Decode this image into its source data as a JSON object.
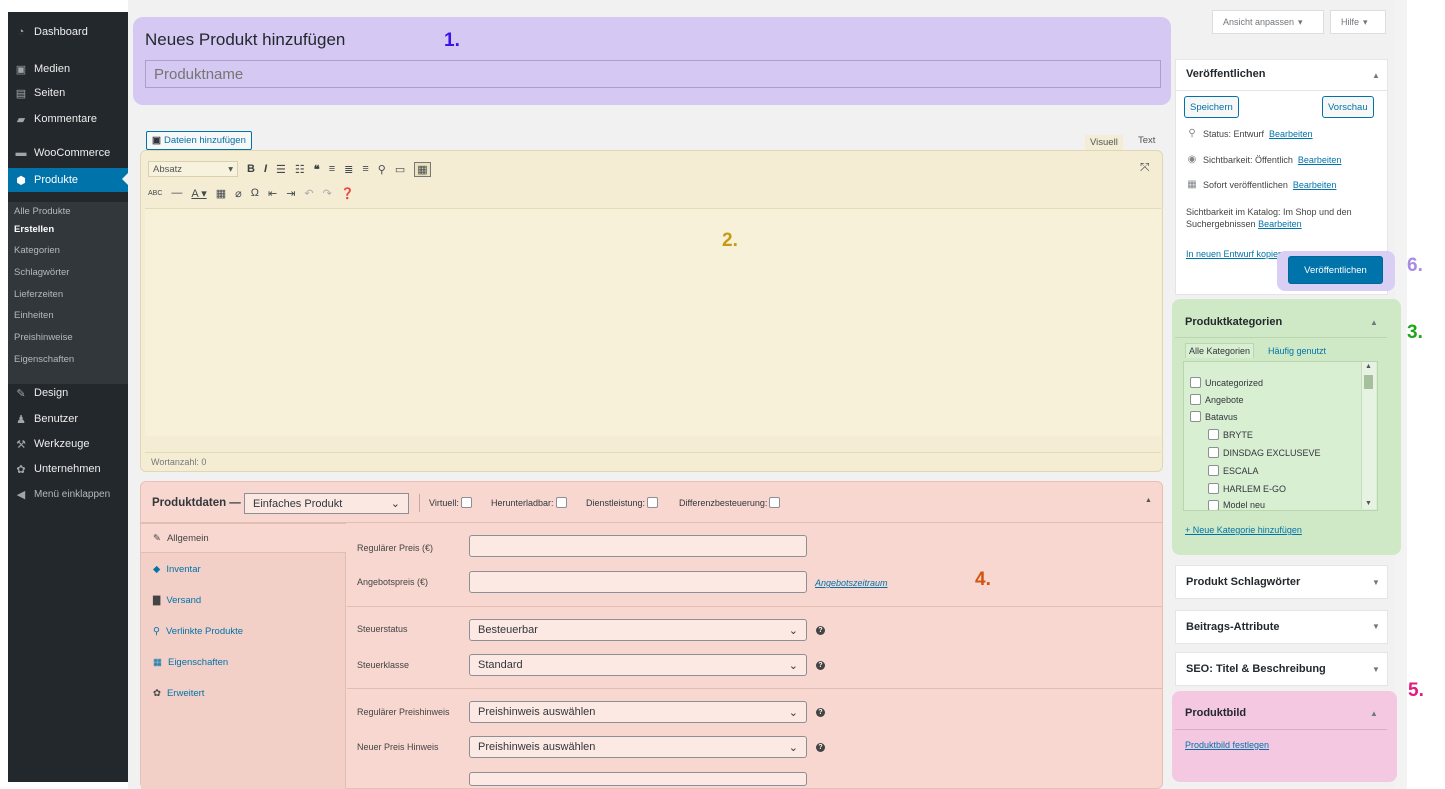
{
  "sidebar": {
    "items": [
      {
        "label": "Dashboard",
        "icon": "dashboard-icon"
      },
      {
        "label": "Medien",
        "icon": "media-icon"
      },
      {
        "label": "Seiten",
        "icon": "pages-icon"
      },
      {
        "label": "Kommentare",
        "icon": "comments-icon"
      },
      {
        "label": "WooCommerce",
        "icon": "woocommerce-icon"
      },
      {
        "label": "Produkte",
        "icon": "products-icon"
      },
      {
        "label": "Design",
        "icon": "brush-icon"
      },
      {
        "label": "Benutzer",
        "icon": "users-icon"
      },
      {
        "label": "Werkzeuge",
        "icon": "wrench-icon"
      },
      {
        "label": "Unternehmen",
        "icon": "gear-icon"
      },
      {
        "label": "Menü einklappen",
        "icon": "collapse-icon"
      }
    ],
    "submenu": [
      "Alle Produkte",
      "Erstellen",
      "Kategorien",
      "Schlagwörter",
      "Lieferzeiten",
      "Einheiten",
      "Preishinweise",
      "Eigenschaften"
    ]
  },
  "title_section": {
    "heading": "Neues Produkt hinzufügen",
    "name_placeholder": "Produktname"
  },
  "markers": {
    "m1": "1.",
    "m2": "2.",
    "m3": "3.",
    "m4": "4.",
    "m5": "5.",
    "m6": "6."
  },
  "marker_colors": {
    "m1": "#3b14e6",
    "m2": "#c69a11",
    "m3": "#22a51d",
    "m4": "#d2540f",
    "m5": "#e01a7e",
    "m6": "#a98be6"
  },
  "editor": {
    "add_media": "Dateien hinzufügen",
    "tab_visual": "Visuell",
    "tab_text": "Text",
    "format": "Absatz",
    "wordcount": "Wortanzahl: 0"
  },
  "product_data": {
    "title": "Produktdaten —",
    "type": "Einfaches Produkt",
    "checks": [
      "Virtuell:",
      "Herunterladbar:",
      "Dienstleistung:",
      "Differenzbesteuerung:"
    ],
    "tabs": [
      {
        "label": "Allgemein",
        "icon": "wrench-icon"
      },
      {
        "label": "Inventar",
        "icon": "tag-icon"
      },
      {
        "label": "Versand",
        "icon": "truck-icon"
      },
      {
        "label": "Verlinkte Produkte",
        "icon": "link-icon"
      },
      {
        "label": "Eigenschaften",
        "icon": "table-icon"
      },
      {
        "label": "Erweitert",
        "icon": "gear-icon"
      }
    ],
    "fields": {
      "regular_price": "Regulärer Preis (€)",
      "sale_price": "Angebotspreis (€)",
      "sale_schedule": "Angebotszeitraum",
      "tax_status_label": "Steuerstatus",
      "tax_status_value": "Besteuerbar",
      "tax_class_label": "Steuerklasse",
      "tax_class_value": "Standard",
      "regular_hint_label": "Regulärer Preishinweis",
      "regular_hint_value": "Preishinweis auswählen",
      "new_hint_label": "Neuer Preis Hinweis",
      "new_hint_value": "Preishinweis auswählen"
    }
  },
  "screen_options": {
    "customize": "Ansicht anpassen",
    "help": "Hilfe"
  },
  "publish": {
    "title": "Veröffentlichen",
    "save": "Speichern",
    "preview": "Vorschau",
    "status": "Status: Entwurf",
    "visibility": "Sichtbarkeit: Öffentlich",
    "schedule": "Sofort veröffentlichen",
    "edit": "Bearbeiten",
    "catalog_visibility": "Sichtbarkeit im Katalog: Im Shop und den Suchergebnissen",
    "copy_draft": "In neuen Entwurf kopieren",
    "publish_button": "Veröffentlichen"
  },
  "categories": {
    "title": "Produktkategorien",
    "tab_all": "Alle Kategorien",
    "tab_popular": "Häufig genutzt",
    "items": [
      {
        "label": "Uncategorized",
        "level": 0
      },
      {
        "label": "Angebote",
        "level": 0
      },
      {
        "label": "Batavus",
        "level": 0
      },
      {
        "label": "BRYTE",
        "level": 1
      },
      {
        "label": "DINSDAG EXCLUSEVE",
        "level": 1
      },
      {
        "label": "ESCALA",
        "level": 1
      },
      {
        "label": "HARLEM E-GO",
        "level": 1
      },
      {
        "label": "Model neu",
        "level": 1
      }
    ],
    "add_new": "+ Neue Kategorie hinzufügen"
  },
  "boxes": {
    "tags": "Produkt Schlagwörter",
    "attributes": "Beitrags-Attribute",
    "seo": "SEO: Titel & Beschreibung"
  },
  "product_image": {
    "title": "Produktbild",
    "set": "Produktbild festlegen"
  }
}
